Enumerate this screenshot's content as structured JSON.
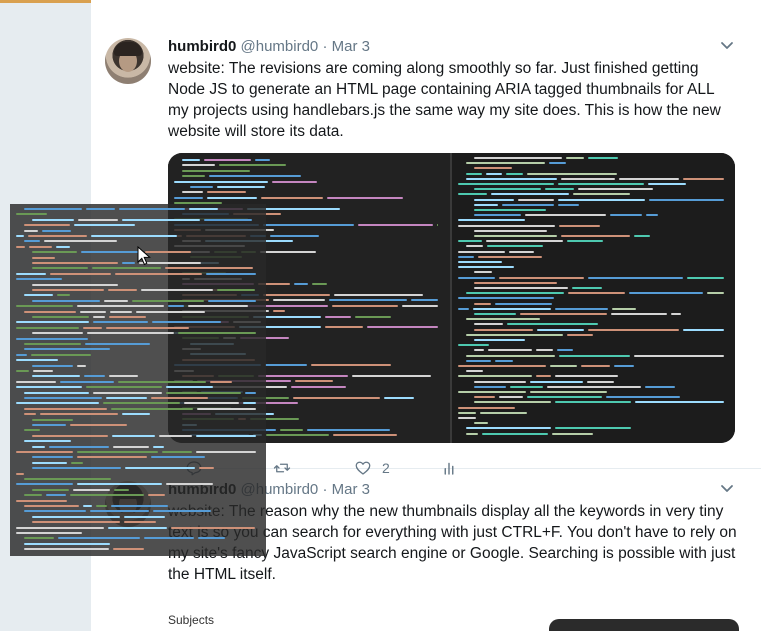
{
  "tweets": [
    {
      "name": "humbird0",
      "handle": "@humbird0",
      "separator": "·",
      "date": "Mar 3",
      "text": "website: The revisions are coming along smoothly so far. Just finished getting Node JS to generate an HTML page containing ARIA tagged thumbnails for ALL my projects using handlebars.js the same way my site does. This is how the new website will store its data.",
      "likes": "2"
    },
    {
      "name": "humbird0",
      "handle": "@humbird0",
      "separator": "·",
      "date": "Mar 3",
      "text": "website: The reason why the new thumbnails display all the keywords in very tiny text is so you can search for everything with just CTRL+F. You don't have to rely on my site's fancy JavaScript search engine or Google. Searching is possible with just the HTML itself.",
      "partial_label": "Subjects"
    }
  ],
  "colors": {
    "accent_bar": "#d9a04f",
    "text_primary": "#14171a",
    "text_secondary": "#657786",
    "background": "#e6ecf0"
  },
  "icons": {
    "reply": "reply-icon",
    "retweet": "retweet-icon",
    "like": "heart-icon",
    "analytics": "analytics-icon",
    "menu": "chevron-down-icon"
  }
}
